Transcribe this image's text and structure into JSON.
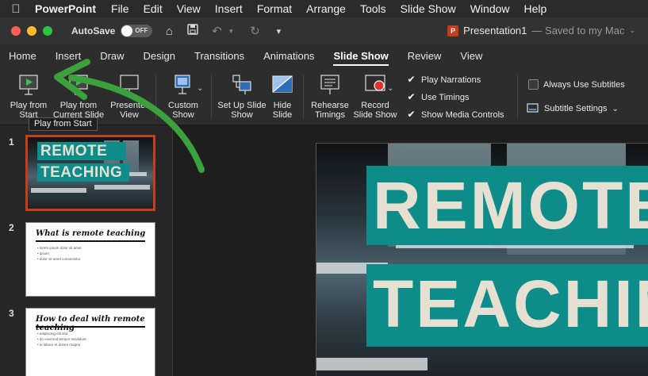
{
  "menubar": {
    "app_name": "PowerPoint",
    "items": [
      "File",
      "Edit",
      "View",
      "Insert",
      "Format",
      "Arrange",
      "Tools",
      "Slide Show",
      "Window",
      "Help"
    ]
  },
  "titlebar": {
    "autosave_label": "AutoSave",
    "autosave_state": "OFF",
    "doc_name": "Presentation1",
    "doc_status": "— Saved to my Mac",
    "badge": "P"
  },
  "tabs": [
    "Home",
    "Insert",
    "Draw",
    "Design",
    "Transitions",
    "Animations",
    "Slide Show",
    "Review",
    "View"
  ],
  "active_tab": "Slide Show",
  "ribbon": {
    "play_from_start": "Play from Start",
    "play_from_current": "Play from Current Slide",
    "presenter_view": "Presenter View",
    "custom_show": "Custom Show",
    "set_up_slide_show": "Set Up Slide Show",
    "hide_slide": "Hide Slide",
    "rehearse_timings": "Rehearse Timings",
    "record_slide_show": "Record Slide Show",
    "play_narrations": "Play Narrations",
    "use_timings": "Use Timings",
    "show_media_controls": "Show Media Controls",
    "always_use_subtitles": "Always Use Subtitles",
    "subtitle_settings": "Subtitle Settings"
  },
  "tooltip": "Play from Start",
  "slides": {
    "s1": {
      "num": "1",
      "line1": "REMOTE",
      "line2": "TEACHING"
    },
    "s2": {
      "num": "2",
      "title": "What is remote teaching",
      "b1": "• lorem ipsum dolor sit amet",
      "b2": "• ipsum",
      "b3": "• dolor sit amet consectetur"
    },
    "s3": {
      "num": "3",
      "title": "How to deal with remote teaching",
      "b1": "• adipiscing elit sed",
      "b2": "• do eiusmod tempor incididunt",
      "b3": "• ut labore et dolore magna"
    }
  },
  "main_slide": {
    "line1": "REMOTE",
    "line2": "TEACHING"
  },
  "colors": {
    "accent": "#0e8c8a",
    "selection": "#c43e1c",
    "arrow": "#3aa13c"
  }
}
